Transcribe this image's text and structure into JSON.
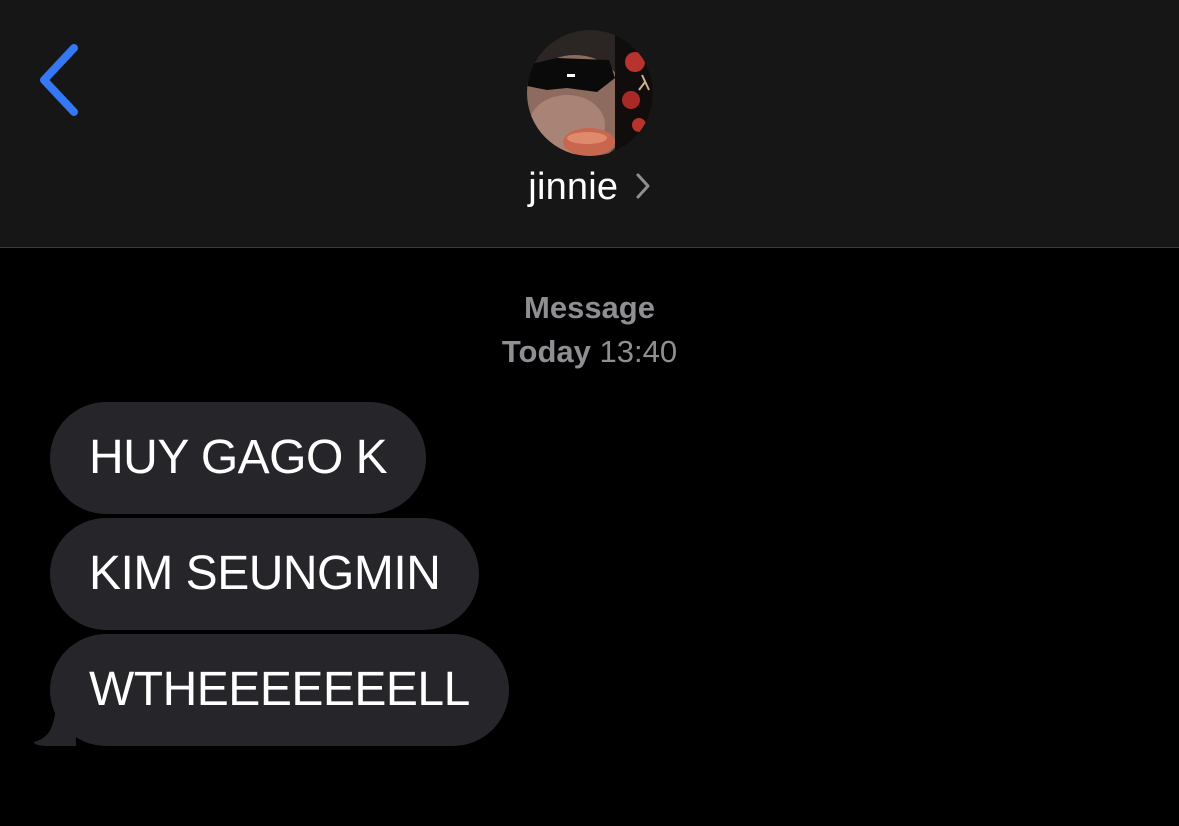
{
  "header": {
    "back_icon": "chevron-left-icon",
    "accent_color": "#3478f6",
    "contact_name": "jinnie",
    "avatar_icon": "contact-photo"
  },
  "conversation": {
    "service_label": "Message",
    "day_label": "Today",
    "time_label": "13:40",
    "messages": [
      {
        "text": "HUY GAGO K",
        "direction": "incoming"
      },
      {
        "text": "KIM SEUNGMIN",
        "direction": "incoming"
      },
      {
        "text": "WTHEEEEEEELL",
        "direction": "incoming"
      }
    ],
    "bubble_color": "#26252a"
  }
}
